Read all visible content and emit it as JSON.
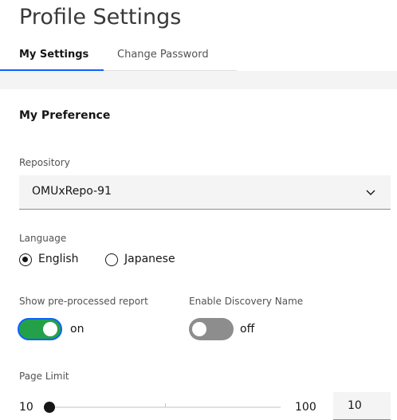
{
  "page": {
    "title": "Profile Settings"
  },
  "tabs": [
    {
      "label": "My Settings",
      "active": true
    },
    {
      "label": "Change Password",
      "active": false
    }
  ],
  "preferences": {
    "section_title": "My Preference",
    "repository": {
      "label": "Repository",
      "value": "OMUxRepo-91",
      "icon": "chevron-down-icon"
    },
    "language": {
      "label": "Language",
      "options": [
        {
          "label": "English",
          "selected": true
        },
        {
          "label": "Japanese",
          "selected": false
        }
      ]
    },
    "preprocessed_report": {
      "label": "Show pre-processed report",
      "state_label": "on",
      "enabled": true
    },
    "discovery_name": {
      "label": "Enable Discovery Name",
      "state_label": "off",
      "enabled": false
    },
    "page_limit": {
      "label": "Page Limit",
      "min_label": "10",
      "max_label": "100",
      "min": 10,
      "max": 100,
      "value": "10"
    }
  },
  "colors": {
    "accent": "#0f62fe",
    "toggle_on": "#24a148",
    "toggle_off": "#8d8d8d",
    "field_background": "#f4f4f4",
    "text": "#161616"
  }
}
